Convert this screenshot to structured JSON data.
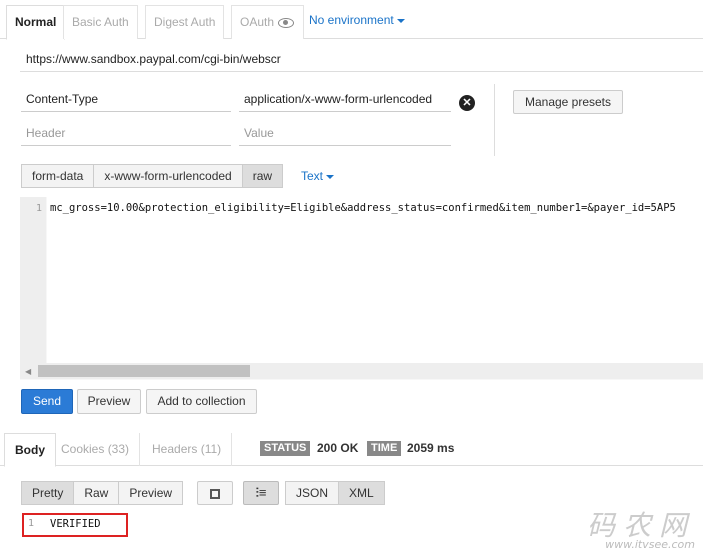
{
  "auth_tabs": [
    "Normal",
    "Basic Auth",
    "Digest Auth",
    "OAuth"
  ],
  "environment": "No environment",
  "url": "https://www.sandbox.paypal.com/cgi-bin/webscr",
  "headers": {
    "key": "Content-Type",
    "value": "application/x-www-form-urlencoded",
    "key_placeholder": "Header",
    "value_placeholder": "Value"
  },
  "manage_presets": "Manage presets",
  "body_modes": [
    "form-data",
    "x-www-form-urlencoded",
    "raw"
  ],
  "raw_type": "Text",
  "editor": {
    "line_number": "1",
    "content": "mc_gross=10.00&protection_eligibility=Eligible&address_status=confirmed&item_number1=&payer_id=5AP5"
  },
  "actions": {
    "send": "Send",
    "preview": "Preview",
    "add_to_collection": "Add to collection"
  },
  "response_tabs": [
    "Body",
    "Cookies (33)",
    "Headers (11)"
  ],
  "status": {
    "label": "STATUS",
    "value": "200 OK"
  },
  "time": {
    "label": "TIME",
    "value": "2059 ms"
  },
  "view_modes": [
    "Pretty",
    "Raw",
    "Preview"
  ],
  "format_modes": [
    "JSON",
    "XML"
  ],
  "response": {
    "line_number": "1",
    "content": "VERIFIED"
  },
  "watermark": {
    "text": "码农网",
    "url": "www.itvsee.com"
  },
  "colors": {
    "accent": "#2b7bd6",
    "highlight_border": "#dd2222"
  }
}
